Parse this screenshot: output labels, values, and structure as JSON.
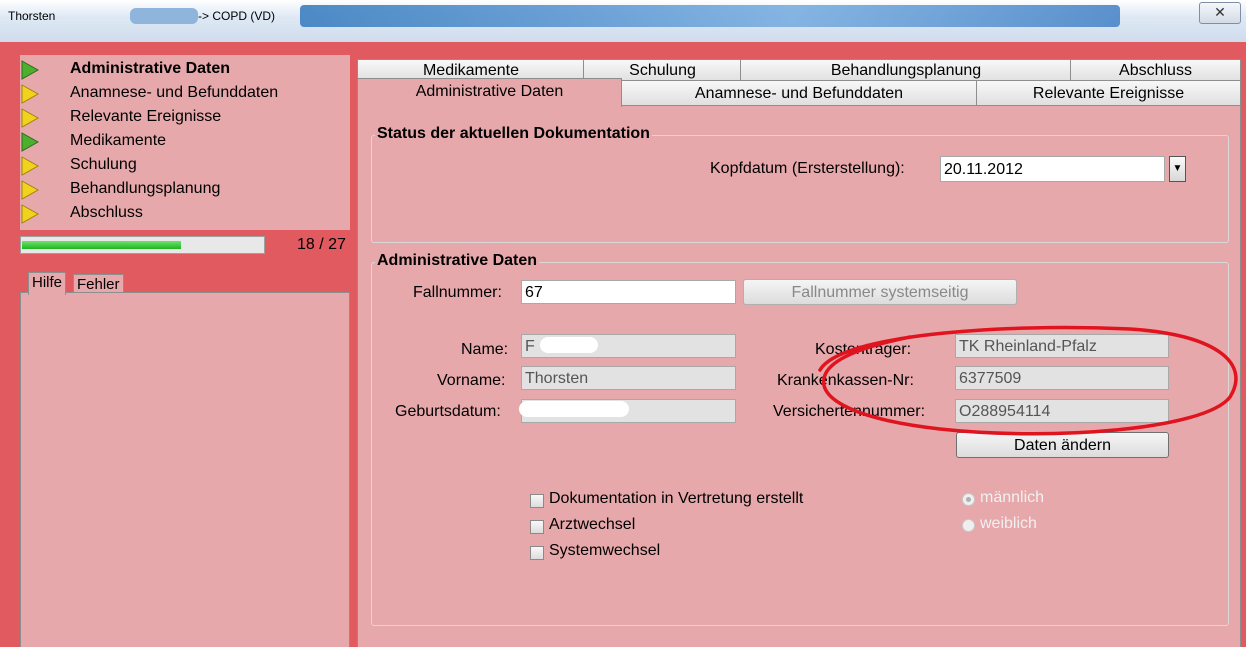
{
  "window": {
    "title_left": "Thorsten",
    "title_right": "-> COPD (VD)",
    "close_label": "✕"
  },
  "nav": {
    "items": [
      {
        "label": "Administrative Daten",
        "state": "green",
        "active": true
      },
      {
        "label": "Anamnese- und Befunddaten",
        "state": "yellow"
      },
      {
        "label": "Relevante Ereignisse",
        "state": "yellow"
      },
      {
        "label": "Medikamente",
        "state": "green"
      },
      {
        "label": "Schulung",
        "state": "yellow"
      },
      {
        "label": "Behandlungsplanung",
        "state": "yellow"
      },
      {
        "label": "Abschluss",
        "state": "yellow"
      }
    ],
    "progress": {
      "value": 18,
      "total": 27,
      "text": "18 / 27"
    }
  },
  "help": {
    "tabs": [
      "Hilfe",
      "Fehler"
    ]
  },
  "tabs": {
    "top_row": [
      "Medikamente",
      "Schulung",
      "Behandlungsplanung",
      "Abschluss"
    ],
    "bottom_row": [
      "Administrative Daten",
      "Anamnese- und Befunddaten",
      "Relevante Ereignisse"
    ]
  },
  "status_group": {
    "legend": "Status der aktuellen Dokumentation",
    "kopfdatum_label": "Kopfdatum (Ersterstellung):",
    "kopfdatum_value": "20.11.2012"
  },
  "admin_group": {
    "legend": "Administrative Daten",
    "fallnummer_label": "Fallnummer:",
    "fallnummer_value": "67",
    "fallnummer_button": "Fallnummer systemseitig",
    "name_label": "Name:",
    "name_value": "F",
    "vorname_label": "Vorname:",
    "vorname_value": "Thorsten",
    "geburtsdatum_label": "Geburtsdatum:",
    "geburtsdatum_value": "",
    "kostentraeger_label": "Kostenträger:",
    "kostentraeger_value": "TK Rheinland-Pfalz",
    "krankenkassen_label": "Krankenkassen-Nr:",
    "krankenkassen_value": "6377509",
    "versichertennummer_label": "Versichertennummer:",
    "versichertennummer_value": "O288954114",
    "daten_aendern_button": "Daten ändern",
    "checkboxes": [
      "Dokumentation in Vertretung erstellt",
      "Arztwechsel",
      "Systemwechsel"
    ],
    "gender": {
      "options": [
        "männlich",
        "weiblich"
      ],
      "selected": "männlich"
    }
  },
  "colors": {
    "window_bg": "#e05a60",
    "panel_bg": "#e7a8ab",
    "annotation": "#e0141e"
  }
}
